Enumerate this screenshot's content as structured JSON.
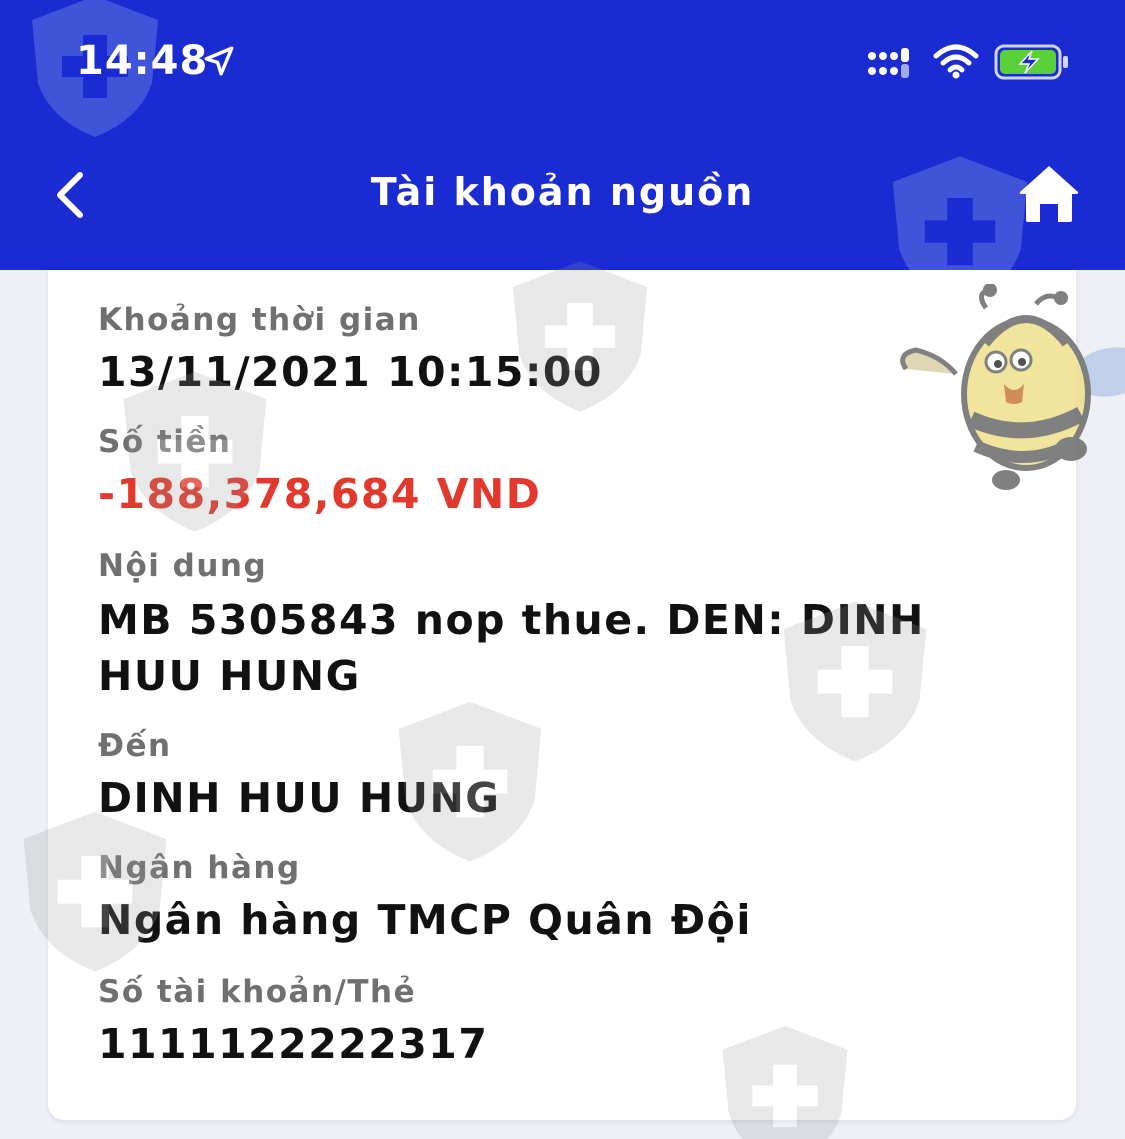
{
  "status": {
    "time": "14:48",
    "icons": [
      "location-arrow-icon",
      "cellular-signal-icon",
      "wifi-icon",
      "battery-charging-icon"
    ]
  },
  "nav": {
    "title": "Tài khoản nguồn",
    "back_icon": "chevron-left-icon",
    "home_icon": "home-icon"
  },
  "colors": {
    "header_bg": "#1a2bd1",
    "amount": "#e3392c",
    "label": "#707070",
    "value": "#111111",
    "battery": "#5ad13b"
  },
  "details": {
    "time_label": "Khoảng thời gian",
    "time_value": "13/11/2021 10:15:00",
    "amount_label": "Số tiền",
    "amount_value": "-188,378,684 VND",
    "content_label": "Nội dung",
    "content_value": "MB 5305843 nop thue. DEN: DINH HUU HUNG",
    "to_label": "Đến",
    "to_value": "DINH HUU HUNG",
    "bank_label": "Ngân hàng",
    "bank_value": "Ngân hàng TMCP Quân Đội",
    "account_label": "Số tài khoản/Thẻ",
    "account_value": "1111122222317"
  }
}
